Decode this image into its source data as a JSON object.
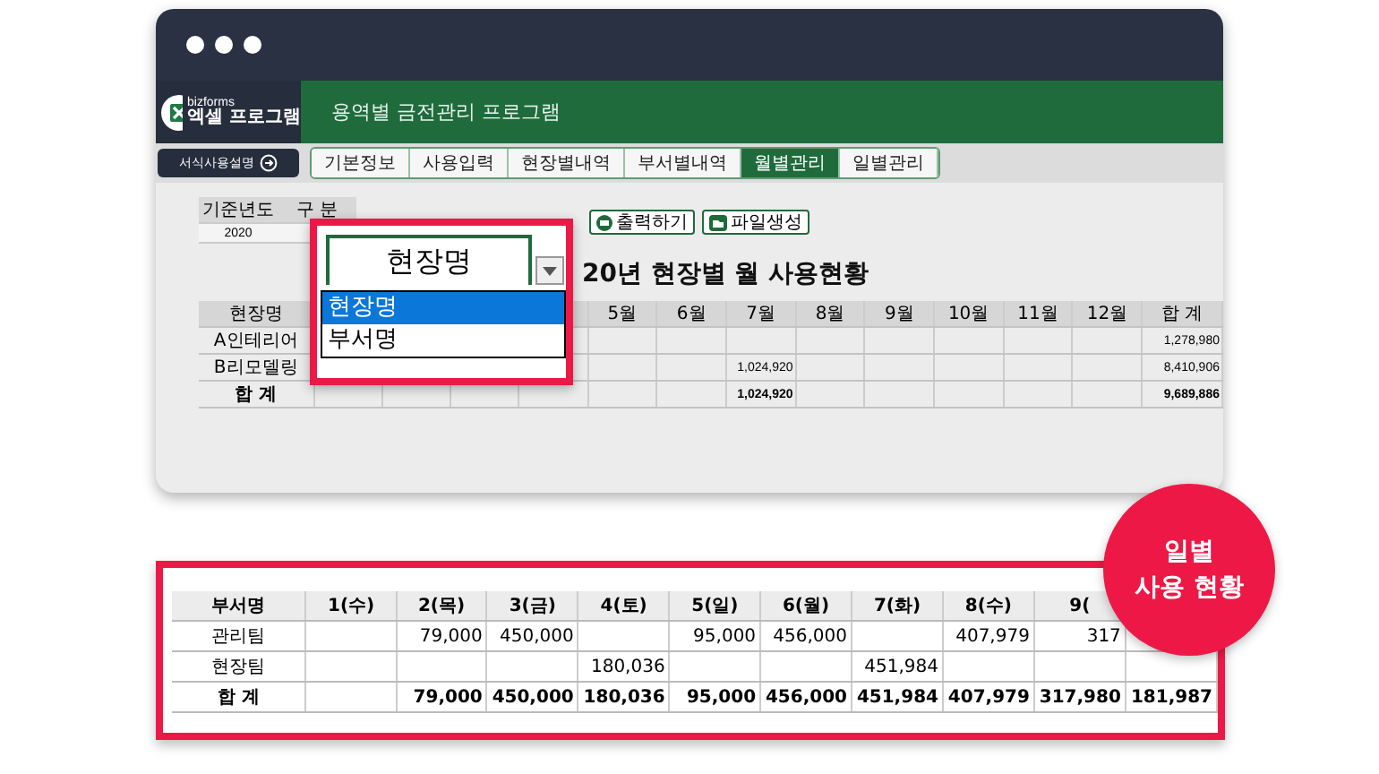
{
  "app": {
    "logo_small": "bizforms",
    "logo_main": "엑셀 프로그램",
    "title": "용역별 금전관리 프로그램"
  },
  "guide_button": "서식사용설명",
  "tabs": [
    {
      "label": "기본정보",
      "selected": false
    },
    {
      "label": "사용입력",
      "selected": false
    },
    {
      "label": "현장별내역",
      "selected": false
    },
    {
      "label": "부서별내역",
      "selected": false
    },
    {
      "label": "월별관리",
      "selected": true
    },
    {
      "label": "일별관리",
      "selected": false
    }
  ],
  "filters": {
    "year_label": "기준년도",
    "year": "2020",
    "type_label": "구 분"
  },
  "buttons": [
    {
      "label": "출력하기",
      "kind": "print"
    },
    {
      "label": "파일생성",
      "kind": "folder"
    }
  ],
  "report_title": "20년 현장별 월 사용현황",
  "monthly_table": {
    "columns": [
      "현장명",
      "5월",
      "6월",
      "7월",
      "8월",
      "9월",
      "10월",
      "11월",
      "12월",
      "합 계"
    ],
    "rows": [
      {
        "total": false,
        "cells": [
          "A인테리어",
          "",
          "",
          "",
          "",
          "",
          "",
          "",
          "",
          "1,278,980"
        ]
      },
      {
        "total": false,
        "cells": [
          "B리모델링",
          "",
          "",
          "1,024,920",
          "",
          "",
          "",
          "",
          "",
          "8,410,906"
        ]
      },
      {
        "total": true,
        "cells": [
          "합 계",
          "",
          "",
          "1,024,920",
          "",
          "",
          "",
          "",
          "",
          "9,689,886"
        ]
      }
    ]
  },
  "dropdown": {
    "value": "현장명",
    "options": [
      {
        "label": "현장명",
        "selected": true
      },
      {
        "label": "부서명",
        "selected": false
      }
    ]
  },
  "daily_table": {
    "columns": [
      "부서명",
      "1(수)",
      "2(목)",
      "3(금)",
      "4(토)",
      "5(일)",
      "6(월)",
      "7(화)",
      "8(수)",
      "9("
    ],
    "rows": [
      {
        "total": false,
        "cells": [
          "관리팀",
          "",
          "79,000",
          "450,000",
          "",
          "95,000",
          "456,000",
          "",
          "407,979",
          "317",
          ""
        ]
      },
      {
        "total": false,
        "cells": [
          "현장팀",
          "",
          "",
          "",
          "180,036",
          "",
          "",
          "451,984",
          "",
          "",
          ""
        ]
      },
      {
        "total": true,
        "cells": [
          "합 계",
          "",
          "79,000",
          "450,000",
          "180,036",
          "95,000",
          "456,000",
          "451,984",
          "407,979",
          "317,980",
          "181,987"
        ]
      }
    ]
  },
  "badge": {
    "line1": "일별",
    "line2": "사용 현황"
  }
}
